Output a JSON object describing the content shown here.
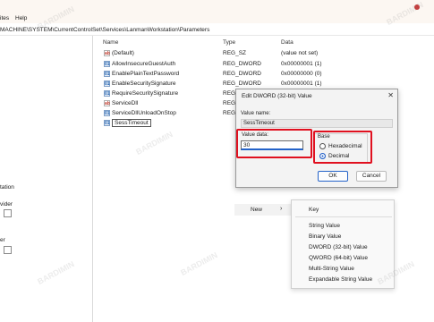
{
  "menubar": {
    "items": [
      "ites",
      "Help"
    ]
  },
  "address": {
    "path": "MACHINE\\SYSTEM\\CurrentControlSet\\Services\\LanmanWorkstation\\Parameters"
  },
  "tree": {
    "items": [
      "tation",
      "vider",
      "er"
    ]
  },
  "columns": {
    "name": "Name",
    "type": "Type",
    "data": "Data"
  },
  "values": [
    {
      "name": "(Default)",
      "type": "REG_SZ",
      "data": "(value not set)",
      "icon": "string"
    },
    {
      "name": "AllowInsecureGuestAuth",
      "type": "REG_DWORD",
      "data": "0x00000001 (1)",
      "icon": "binary"
    },
    {
      "name": "EnablePlainTextPassword",
      "type": "REG_DWORD",
      "data": "0x00000000 (0)",
      "icon": "binary"
    },
    {
      "name": "EnableSecuritySignature",
      "type": "REG_DWORD",
      "data": "0x00000001 (1)",
      "icon": "binary"
    },
    {
      "name": "RequireSecuritySignature",
      "type": "REG_",
      "data": "",
      "icon": "binary"
    },
    {
      "name": "ServiceDll",
      "type": "REG_",
      "data": "",
      "icon": "string"
    },
    {
      "name": "ServiceDllUnloadOnStop",
      "type": "REG_",
      "data": "",
      "icon": "binary"
    },
    {
      "name": "SessTimeout",
      "type": "",
      "data": "",
      "icon": "binary"
    }
  ],
  "dialog": {
    "title": "Edit DWORD (32-bit) Value",
    "close_glyph": "✕",
    "value_name_label": "Value name:",
    "value_name": "SessTimeout",
    "value_data_label": "Value data:",
    "value_data": "30",
    "base_label": "Base",
    "hex_label": "Hexadecimal",
    "dec_label": "Decimal",
    "base_selected": "Decimal",
    "ok_label": "OK",
    "cancel_label": "Cancel"
  },
  "context": {
    "new_label": "New",
    "arrow_glyph": "›",
    "submenu": [
      "Key",
      "String Value",
      "Binary Value",
      "DWORD (32-bit) Value",
      "QWORD (64-bit) Value",
      "Multi-String Value",
      "Expandable String Value"
    ]
  },
  "watermark": {
    "text": "BARDIMIN"
  },
  "colors": {
    "highlight": "#e0101f",
    "accent": "#2463c9"
  }
}
